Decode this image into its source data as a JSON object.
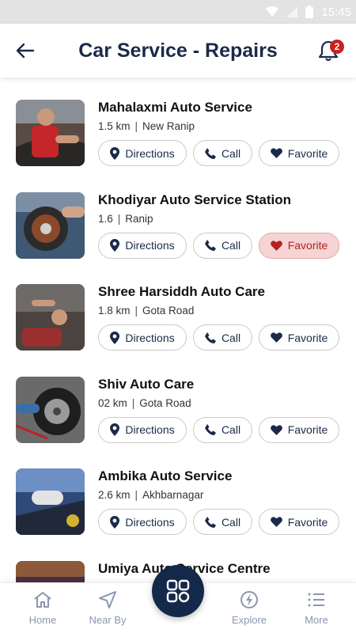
{
  "status_bar": {
    "time": "15:45",
    "icons": [
      "wifi-icon",
      "signal-icon",
      "battery-icon"
    ]
  },
  "header": {
    "title": "Car Service - Repairs",
    "notification_count": "2"
  },
  "actions": {
    "directions": "Directions",
    "call": "Call",
    "favorite": "Favorite"
  },
  "colors": {
    "navy": "#1b2a4a",
    "fab": "#14294a",
    "badge": "#cc1f1f",
    "favorite_active_bg": "#f7d4d4",
    "favorite_active_text": "#b22222",
    "nav_inactive": "#8a97ae"
  },
  "services": [
    {
      "name": "Mahalaxmi Auto Service",
      "distance": "1.5 km",
      "location": "New Ranip",
      "favorite": false
    },
    {
      "name": "Khodiyar Auto Service Station",
      "distance": "1.6",
      "location": "Ranip",
      "favorite": true
    },
    {
      "name": "Shree Harsiddh Auto Care",
      "distance": "1.8 km",
      "location": "Gota Road",
      "favorite": false
    },
    {
      "name": "Shiv Auto Care",
      "distance": "02 km",
      "location": "Gota Road",
      "favorite": false
    },
    {
      "name": "Ambika Auto Service",
      "distance": "2.6 km",
      "location": "Akhbarnagar",
      "favorite": false
    },
    {
      "name": "Umiya Auto Service Centre"
    }
  ],
  "bottom_nav": {
    "home": "Home",
    "nearby": "Near By",
    "explore": "Explore",
    "more": "More"
  }
}
